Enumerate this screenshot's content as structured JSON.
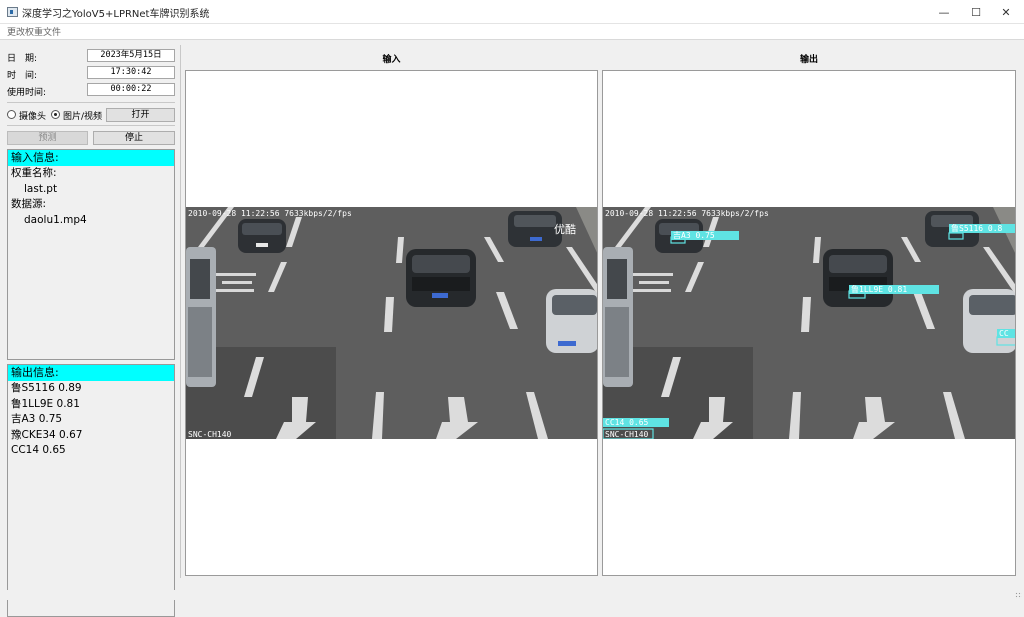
{
  "window": {
    "title": "深度学习之YoloV5+LPRNet车牌识别系统",
    "minimize": "—",
    "maximize": "☐",
    "close": "✕"
  },
  "menu": {
    "item": "更改权重文件"
  },
  "left": {
    "date_label": "日　期:",
    "date_value": "2023年5月15日",
    "time_label": "时　间:",
    "time_value": "17:30:42",
    "usage_label": "使用时间:",
    "usage_value": "00:00:22",
    "radio_camera": "摄像头",
    "radio_file": "图片/视频",
    "open_button": "打开",
    "predict_button": "预测",
    "stop_button": "停止",
    "input_info": {
      "header": "输入信息:",
      "weight_label": "权重名称:",
      "weight_value": "last.pt",
      "source_label": "数据源:",
      "source_value": "daolu1.mp4"
    },
    "output_info": {
      "header": "输出信息:",
      "results": [
        "鲁S5116 0.89",
        "鲁1LL9E 0.81",
        "吉A3 0.75",
        "豫CKE34 0.67",
        "CC14 0.65"
      ]
    }
  },
  "panes": {
    "input_title": "输入",
    "output_title": "输出",
    "osd_top": "2010-09-28 11:22:56 7633kbps/2/fps",
    "osd_bottom": "SNC-CH140",
    "watermark": "优酷",
    "detections": [
      "吉A3 0.75",
      "鲁1LL9E 0.81",
      "鲁S5116 0.8",
      "CC14 0.65",
      "CC"
    ]
  },
  "colors": {
    "cyan_header": "#00ffff",
    "box_cyan": "#5fe3e3"
  }
}
